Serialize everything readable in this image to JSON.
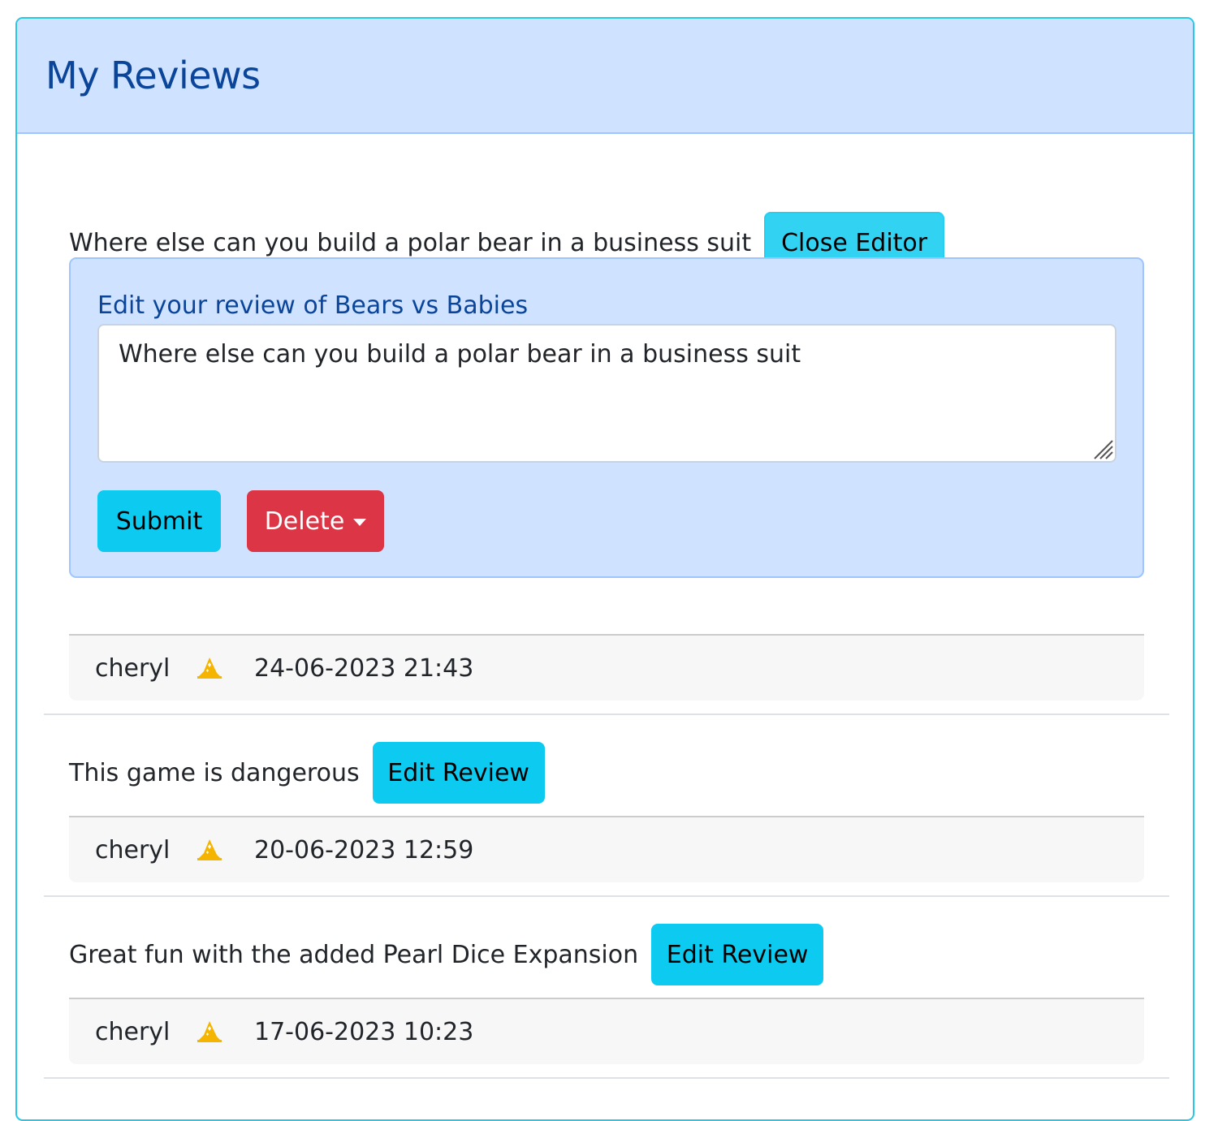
{
  "header": {
    "title": "My Reviews"
  },
  "reviews": [
    {
      "text": "Where else can you build a polar bear in a business suit",
      "button_label": "Close Editor",
      "editor": {
        "label": "Edit your review of Bears vs Babies",
        "textarea_value": "Where else can you build a polar bear in a business suit",
        "submit_label": "Submit",
        "delete_label": "Delete"
      },
      "author": "cheryl",
      "author_icon": "wizard-hat-icon",
      "timestamp": "24-06-2023 21:43"
    },
    {
      "text": "This game is dangerous",
      "button_label": "Edit Review",
      "author": "cheryl",
      "author_icon": "wizard-hat-icon",
      "timestamp": "20-06-2023 12:59"
    },
    {
      "text": "Great fun with the added Pearl Dice Expansion",
      "button_label": "Edit Review",
      "author": "cheryl",
      "author_icon": "wizard-hat-icon",
      "timestamp": "17-06-2023 10:23"
    }
  ],
  "colors": {
    "header_bg": "#cfe2ff",
    "header_text": "#0a4599",
    "card_border": "#29c6e6",
    "info_button": "#0dcaf0",
    "danger_button": "#dc3545",
    "wizard_icon": "#f5b400"
  }
}
